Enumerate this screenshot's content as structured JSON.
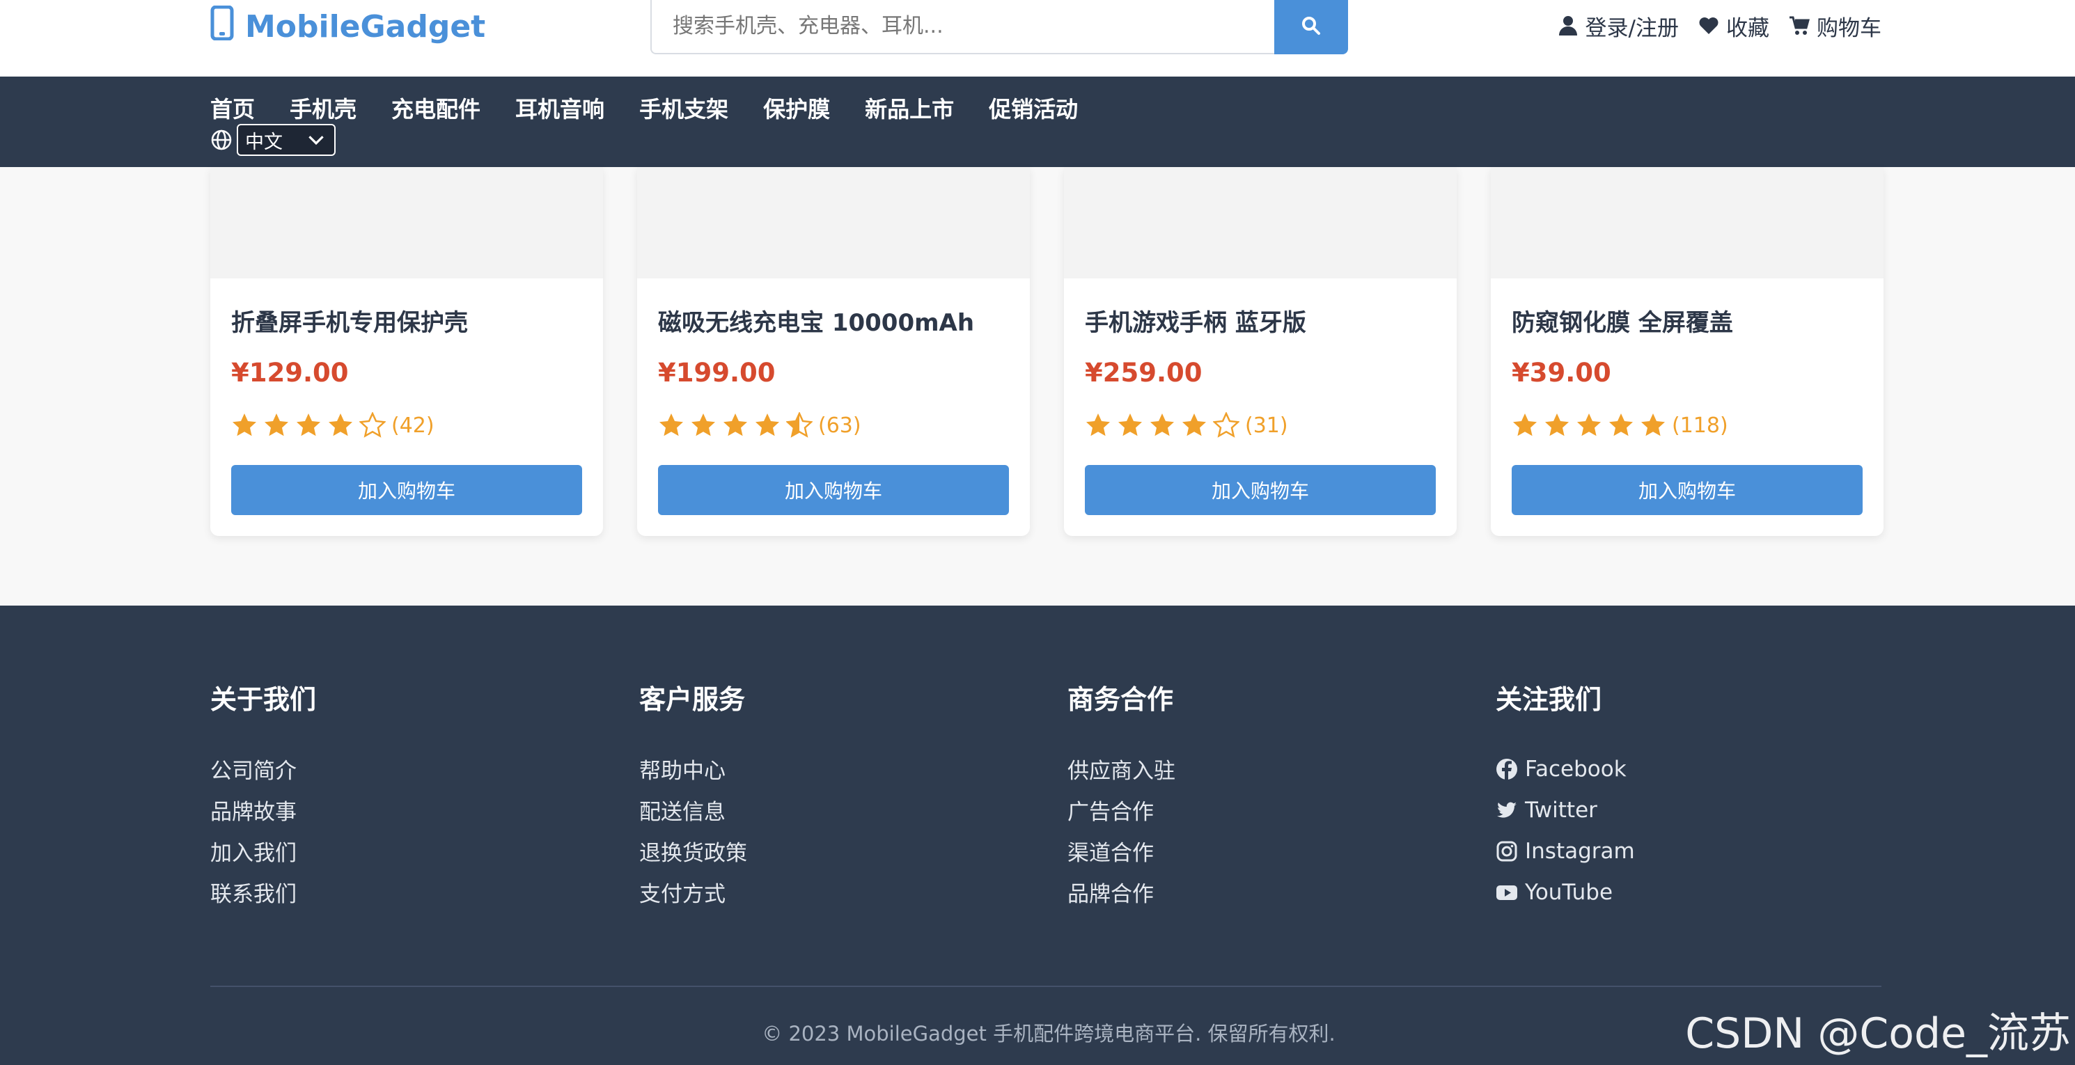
{
  "header": {
    "logo_text": "MobileGadget",
    "logo_icon": "phone-icon",
    "search_placeholder": "搜索手机壳、充电器、耳机...",
    "search_icon": "search-icon",
    "login_label": "登录/注册",
    "favorites_label": "收藏",
    "cart_label": "购物车"
  },
  "nav": {
    "items": [
      "首页",
      "手机壳",
      "充电配件",
      "耳机音响",
      "手机支架",
      "保护膜",
      "新品上市",
      "促销活动"
    ],
    "language_icon": "globe-icon",
    "language_selected": "中文"
  },
  "products": [
    {
      "title": "折叠屏手机专用保护壳",
      "price": "¥129.00",
      "rating": 4,
      "reviews": "(42)",
      "button": "加入购物车"
    },
    {
      "title": "磁吸无线充电宝 10000mAh",
      "price": "¥199.00",
      "rating": 4.5,
      "reviews": "(63)",
      "button": "加入购物车"
    },
    {
      "title": "手机游戏手柄 蓝牙版",
      "price": "¥259.00",
      "rating": 4,
      "reviews": "(31)",
      "button": "加入购物车"
    },
    {
      "title": "防窥钢化膜 全屏覆盖",
      "price": "¥39.00",
      "rating": 5,
      "reviews": "(118)",
      "button": "加入购物车"
    }
  ],
  "footer": {
    "columns": [
      {
        "title": "关于我们",
        "items": [
          "公司简介",
          "品牌故事",
          "加入我们",
          "联系我们"
        ]
      },
      {
        "title": "客户服务",
        "items": [
          "帮助中心",
          "配送信息",
          "退换货政策",
          "支付方式"
        ]
      },
      {
        "title": "商务合作",
        "items": [
          "供应商入驻",
          "广告合作",
          "渠道合作",
          "品牌合作"
        ]
      },
      {
        "title": "关注我们",
        "items": [
          "Facebook",
          "Twitter",
          "Instagram",
          "YouTube"
        ]
      }
    ],
    "copyright": "© 2023 MobileGadget 手机配件跨境电商平台. 保留所有权利.",
    "watermark": "CSDN @Code_流苏"
  },
  "colors": {
    "accent": "#4a90d9",
    "price": "#d64a2e",
    "star": "#f0a02a",
    "nav_bg": "#2e3b4e"
  }
}
